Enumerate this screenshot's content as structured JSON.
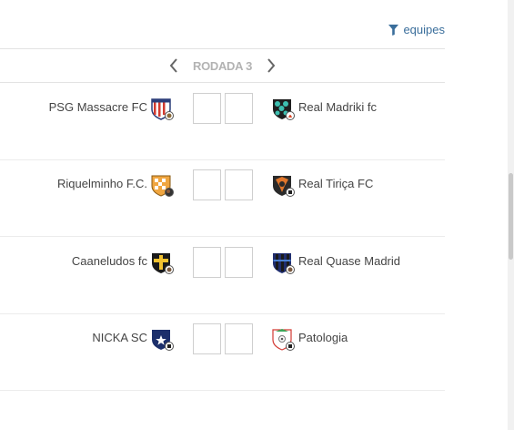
{
  "filter": {
    "label": "equipes",
    "icon": "filter-icon",
    "color": "#3a6e9b"
  },
  "round": {
    "title": "RODADA 3",
    "prev_icon": "chevron-left-icon",
    "next_icon": "chevron-right-icon"
  },
  "matches": [
    {
      "home": {
        "name": "PSG Massacre FC",
        "crest": "shield-crest-icon"
      },
      "away": {
        "name": "Real Madriki fc",
        "crest": "shield-crest-icon"
      },
      "score_home": "",
      "score_away": ""
    },
    {
      "home": {
        "name": "Riquelminho F.C.",
        "crest": "shield-crest-icon"
      },
      "away": {
        "name": "Real Tiriça FC",
        "crest": "shield-crest-icon"
      },
      "score_home": "",
      "score_away": ""
    },
    {
      "home": {
        "name": "Caaneludos fc",
        "crest": "shield-crest-icon"
      },
      "away": {
        "name": "Real Quase Madrid",
        "crest": "shield-crest-icon"
      },
      "score_home": "",
      "score_away": ""
    },
    {
      "home": {
        "name": "NICKA SC",
        "crest": "shield-crest-icon"
      },
      "away": {
        "name": "Patologia",
        "crest": "shield-crest-icon"
      },
      "score_home": "",
      "score_away": ""
    }
  ]
}
